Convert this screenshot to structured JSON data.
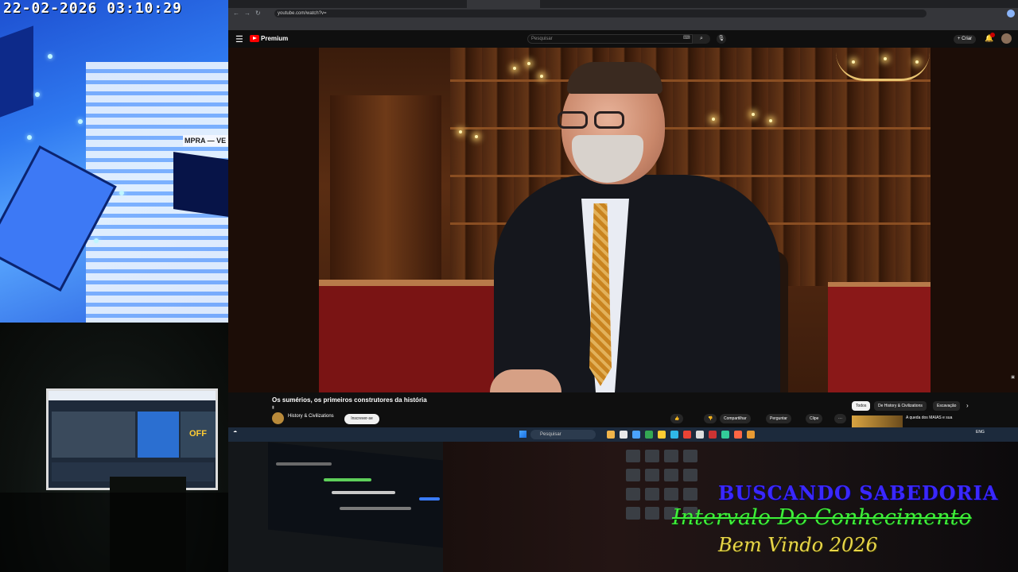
{
  "camera": {
    "timestamp": "22-02-2026  03:10:29",
    "sign_text": "MPRA — VE"
  },
  "studio": {
    "monitor_label": "OFF"
  },
  "browser": {
    "tabs": [
      "",
      "",
      "",
      "",
      "",
      ""
    ],
    "url": "youtube.com/watch?v=",
    "bookmark": "",
    "signin_label": ""
  },
  "youtube": {
    "logo_text": "Premium",
    "search_placeholder": "Pesquisar",
    "create_label": "+ Criar",
    "video_title": "Os sumérios, os primeiros construtores da história",
    "channel_name": "History & Civilizations",
    "subscribe_label": "Inscrever-se",
    "actions": {
      "like": "👍",
      "share": "Compartilhar",
      "ask": "Perguntar",
      "clip": "Clipe",
      "more": "···"
    },
    "chips": {
      "all": "Todos",
      "channel": "De History & Civilizations",
      "related": "Escavação"
    },
    "recommendation": "A queda dos MAIAS e sua"
  },
  "taskbar": {
    "search_placeholder": "Pesquisar",
    "tray_lang": "ENG"
  },
  "overlay": {
    "line1": "BUSCANDO  SABEDORIA",
    "line2": "Intervalo Do Conhecimento",
    "line3": "Bem Vindo 2026"
  },
  "colors": {
    "overlay_line1": "#3a28ff",
    "overlay_line2": "#3ff03a",
    "overlay_line3": "#e9d64a",
    "youtube_red": "#ff0000"
  }
}
